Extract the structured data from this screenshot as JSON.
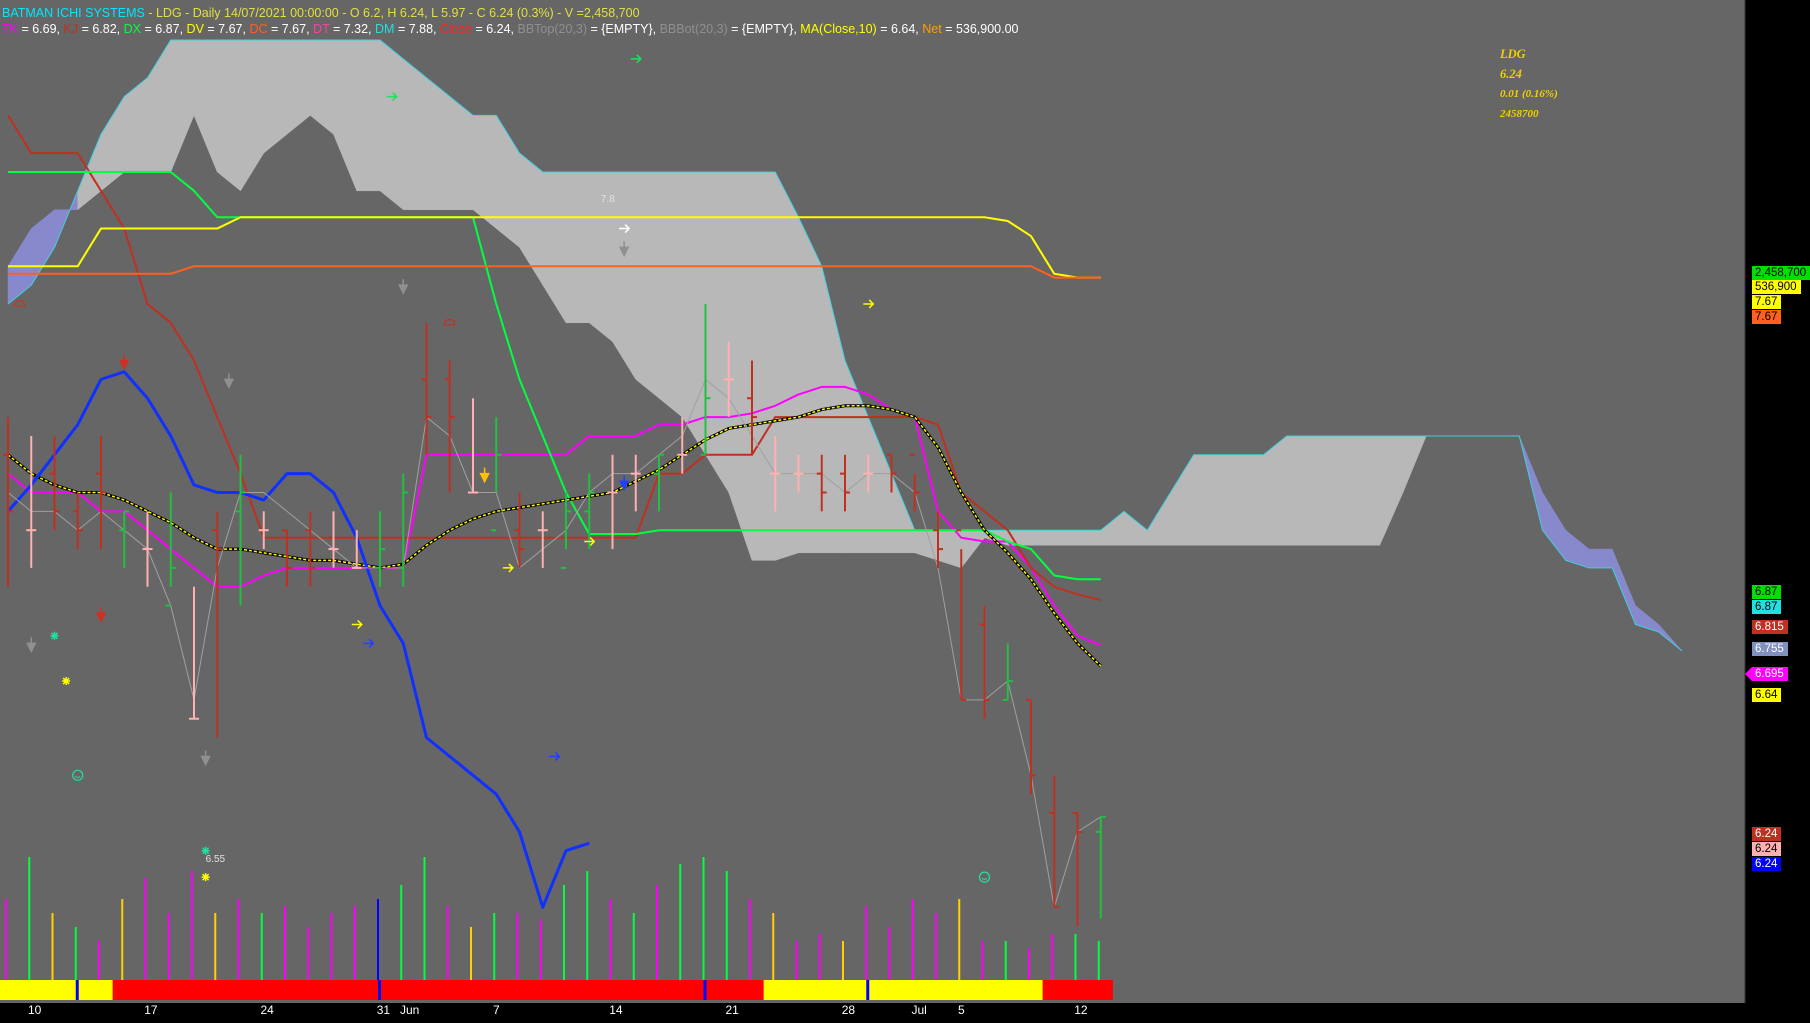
{
  "header": {
    "system": "BATMAN ICHI SYSTEMS",
    "symbol": "LDG",
    "period": "Daily",
    "date": "14/07/2021 00:00:00",
    "ohlc": "O 6.2, H 6.24, L 5.97",
    "close": "C 6.24 (0.3%)",
    "volume": "V =2,458,700"
  },
  "indicators": [
    {
      "label": "TK",
      "value": " = 6.69, ",
      "color": "#ff00ff"
    },
    {
      "label": "KJ",
      "value": " = 6.82, ",
      "color": "#c03020"
    },
    {
      "label": "DX",
      "value": " = 6.87, ",
      "color": "#00ff40"
    },
    {
      "label": "DV",
      "value": " = 7.67, ",
      "color": "#ffff00"
    },
    {
      "label": "DC",
      "value": " = 7.67, ",
      "color": "#ff6020"
    },
    {
      "label": "DT",
      "value": " = 7.32, ",
      "color": "#ff40a0"
    },
    {
      "label": "DM",
      "value": " = 7.88, ",
      "color": "#20e0e0"
    },
    {
      "label": "Close",
      "value": " = 6.24, ",
      "color": "#ff2020"
    },
    {
      "label": "BBTop(20,3)",
      "value": " = {EMPTY}, ",
      "color": "#909090"
    },
    {
      "label": "BBBot(20,3)",
      "value": " = {EMPTY}, ",
      "color": "#909090"
    },
    {
      "label": "MA(Close,10)",
      "value": " = 6.64, ",
      "color": "#ffff00"
    },
    {
      "label": "Net",
      "value": " = 536,900.00",
      "color": "#ffa000"
    }
  ],
  "quote": {
    "symbol": "LDG",
    "last": "6.24",
    "change": "0.01 (0.16%)",
    "volume": "2458700"
  },
  "axis_labels": [
    {
      "text": "2,458,700",
      "bg": "#00e000",
      "fg": "#000000",
      "tip": false
    },
    {
      "text": "536,900",
      "bg": "#ffff00",
      "fg": "#000000",
      "tip": false
    },
    {
      "text": "7.67",
      "bg": "#ffff00",
      "fg": "#000000",
      "tip": false
    },
    {
      "text": "7.67",
      "bg": "#ff6020",
      "fg": "#000000",
      "tip": false
    },
    {
      "text": "6.87",
      "bg": "#00e000",
      "fg": "#000000",
      "tip": false
    },
    {
      "text": "6.87",
      "bg": "#20e0e0",
      "fg": "#000000",
      "tip": false
    },
    {
      "text": "6.815",
      "bg": "#c03020",
      "fg": "#ffffff",
      "tip": false
    },
    {
      "text": "6.755",
      "bg": "#8090c0",
      "fg": "#ffffff",
      "tip": false
    },
    {
      "text": "6.695",
      "bg": "#ff00ff",
      "fg": "#ffffff",
      "tip": true
    },
    {
      "text": "6.64",
      "bg": "#ffff00",
      "fg": "#000000",
      "tip": false
    },
    {
      "text": "6.24",
      "bg": "#c03020",
      "fg": "#ffffff",
      "tip": false
    },
    {
      "text": "6.24",
      "bg": "#ffb0b0",
      "fg": "#000000",
      "tip": false
    },
    {
      "text": "6.24",
      "bg": "#0000ff",
      "fg": "#ffffff",
      "tip": false
    }
  ],
  "notes": [
    {
      "text": "7.8"
    },
    {
      "text": "6.55"
    }
  ],
  "chart_data": {
    "type": "line",
    "price_range": [
      5.9,
      8.3
    ],
    "x": [
      "10",
      "11",
      "12",
      "13",
      "14",
      "17",
      "18",
      "19",
      "20",
      "21",
      "24",
      "25",
      "26",
      "27",
      "28",
      "31",
      "1",
      "2",
      "3",
      "4",
      "7",
      "8",
      "9",
      "10",
      "11",
      "14",
      "15",
      "16",
      "17",
      "18",
      "21",
      "22",
      "23",
      "24",
      "25",
      "28",
      "29",
      "30",
      "1",
      "2",
      "5",
      "6",
      "7",
      "8",
      "9",
      "12",
      "13",
      "14"
    ],
    "x_tick_labels": [
      {
        "i": 0,
        "label": "10"
      },
      {
        "i": 5,
        "label": "17"
      },
      {
        "i": 10,
        "label": "24"
      },
      {
        "i": 15,
        "label": "31"
      },
      {
        "i": 16,
        "label": "Jun"
      },
      {
        "i": 20,
        "label": "7"
      },
      {
        "i": 25,
        "label": "14"
      },
      {
        "i": 30,
        "label": "21"
      },
      {
        "i": 35,
        "label": "28"
      },
      {
        "i": 38,
        "label": "Jul"
      },
      {
        "i": 40,
        "label": "5"
      },
      {
        "i": 45,
        "label": "12"
      }
    ],
    "ohlc": [
      [
        7.2,
        7.3,
        6.85,
        7.05
      ],
      [
        7.0,
        7.25,
        6.9,
        7.0
      ],
      [
        7.15,
        7.25,
        7.0,
        7.05
      ],
      [
        7.05,
        7.1,
        6.95,
        7.0
      ],
      [
        7.15,
        7.25,
        6.95,
        7.1
      ],
      [
        7.0,
        7.05,
        6.9,
        7.05
      ],
      [
        6.95,
        7.05,
        6.85,
        6.95
      ],
      [
        6.8,
        7.1,
        6.85,
        6.9
      ],
      [
        6.5,
        6.85,
        6.5,
        6.5
      ],
      [
        7.0,
        7.05,
        6.45,
        6.95
      ],
      [
        7.05,
        7.2,
        6.8,
        7.1
      ],
      [
        7.0,
        7.05,
        6.95,
        7.0
      ],
      [
        7.0,
        7.0,
        6.85,
        6.9
      ],
      [
        7.0,
        7.05,
        6.85,
        6.9
      ],
      [
        6.95,
        7.05,
        6.9,
        6.95
      ],
      [
        6.9,
        7.0,
        6.9,
        6.9
      ],
      [
        6.9,
        7.05,
        6.85,
        6.95
      ],
      [
        6.9,
        7.15,
        6.85,
        7.1
      ],
      [
        7.4,
        7.55,
        7.2,
        7.3
      ],
      [
        7.4,
        7.45,
        7.1,
        7.3
      ],
      [
        7.1,
        7.35,
        7.1,
        7.1
      ],
      [
        7.0,
        7.3,
        7.1,
        7.2
      ],
      [
        7.0,
        7.1,
        6.9,
        6.95
      ],
      [
        7.0,
        7.05,
        6.9,
        7.0
      ],
      [
        6.9,
        7.1,
        6.95,
        7.05
      ],
      [
        7.05,
        7.15,
        6.95,
        7.1
      ],
      [
        7.1,
        7.2,
        6.95,
        7.1
      ],
      [
        7.15,
        7.2,
        7.05,
        7.15
      ],
      [
        7.15,
        7.2,
        7.05,
        7.2
      ],
      [
        7.2,
        7.3,
        7.15,
        7.2
      ],
      [
        7.2,
        7.6,
        7.2,
        7.35
      ],
      [
        7.4,
        7.5,
        7.3,
        7.4
      ],
      [
        7.35,
        7.45,
        7.2,
        7.3
      ],
      [
        7.15,
        7.25,
        7.05,
        7.15
      ],
      [
        7.15,
        7.2,
        7.1,
        7.15
      ],
      [
        7.15,
        7.2,
        7.05,
        7.1
      ],
      [
        7.15,
        7.2,
        7.05,
        7.1
      ],
      [
        7.15,
        7.2,
        7.1,
        7.15
      ],
      [
        7.2,
        7.2,
        7.1,
        7.15
      ],
      [
        7.2,
        7.15,
        7.05,
        7.1
      ],
      [
        7.0,
        7.05,
        6.9,
        6.95
      ],
      [
        7.0,
        6.95,
        6.55,
        6.55
      ],
      [
        6.75,
        6.8,
        6.5,
        6.55
      ],
      [
        6.55,
        6.7,
        6.55,
        6.6
      ],
      [
        6.55,
        6.55,
        6.3,
        6.35
      ],
      [
        6.25,
        6.35,
        6.0,
        6.0
      ],
      [
        6.25,
        6.25,
        5.95,
        6.2
      ],
      [
        6.2,
        6.24,
        5.97,
        6.24
      ]
    ],
    "series": [
      {
        "name": "TK",
        "color": "#ff00ff",
        "values": [
          7.15,
          7.1,
          7.1,
          7.1,
          7.05,
          7.05,
          7.0,
          6.95,
          6.9,
          6.85,
          6.85,
          6.88,
          6.9,
          6.9,
          6.9,
          6.9,
          6.9,
          6.9,
          7.2,
          7.2,
          7.2,
          7.2,
          7.2,
          7.2,
          7.2,
          7.25,
          7.25,
          7.25,
          7.28,
          7.28,
          7.3,
          7.3,
          7.31,
          7.33,
          7.36,
          7.38,
          7.38,
          7.36,
          7.32,
          7.3,
          7.05,
          6.98,
          6.97,
          6.97,
          6.9,
          6.8,
          6.72,
          6.695
        ]
      },
      {
        "name": "KJ",
        "color": "#c03020",
        "values": [
          8.1,
          8.0,
          8.0,
          8.0,
          7.9,
          7.8,
          7.6,
          7.55,
          7.45,
          7.3,
          7.15,
          6.98,
          6.98,
          6.98,
          6.98,
          6.98,
          6.98,
          6.98,
          6.98,
          6.98,
          6.98,
          6.98,
          6.98,
          6.98,
          6.98,
          6.98,
          6.98,
          6.98,
          7.15,
          7.15,
          7.2,
          7.2,
          7.2,
          7.3,
          7.3,
          7.3,
          7.3,
          7.3,
          7.3,
          7.3,
          7.28,
          7.1,
          7.05,
          7.0,
          6.9,
          6.85,
          6.83,
          6.815
        ]
      },
      {
        "name": "DX",
        "color": "#00ff40",
        "values": [
          7.95,
          7.95,
          7.95,
          7.95,
          7.95,
          7.95,
          7.95,
          7.95,
          7.9,
          7.83,
          7.83,
          7.83,
          7.83,
          7.83,
          7.83,
          7.83,
          7.83,
          7.83,
          7.83,
          7.83,
          7.83,
          7.6,
          7.4,
          7.25,
          7.1,
          6.99,
          6.99,
          6.99,
          7.0,
          7.0,
          7.0,
          7.0,
          7.0,
          7.0,
          7.0,
          7.0,
          7.0,
          7.0,
          7.0,
          7.0,
          7.0,
          7.0,
          7.0,
          6.97,
          6.95,
          6.88,
          6.87,
          6.87
        ]
      },
      {
        "name": "DV",
        "color": "#ffff00",
        "values": [
          7.7,
          7.7,
          7.7,
          7.7,
          7.8,
          7.8,
          7.8,
          7.8,
          7.8,
          7.8,
          7.83,
          7.83,
          7.83,
          7.83,
          7.83,
          7.83,
          7.83,
          7.83,
          7.83,
          7.83,
          7.83,
          7.83,
          7.83,
          7.83,
          7.83,
          7.83,
          7.83,
          7.83,
          7.83,
          7.83,
          7.83,
          7.83,
          7.83,
          7.83,
          7.83,
          7.83,
          7.83,
          7.83,
          7.83,
          7.83,
          7.83,
          7.83,
          7.83,
          7.82,
          7.78,
          7.68,
          7.67,
          7.67
        ]
      },
      {
        "name": "DC",
        "color": "#ff6020",
        "values": [
          7.68,
          7.68,
          7.68,
          7.68,
          7.68,
          7.68,
          7.68,
          7.68,
          7.7,
          7.7,
          7.7,
          7.7,
          7.7,
          7.7,
          7.7,
          7.7,
          7.7,
          7.7,
          7.7,
          7.7,
          7.7,
          7.7,
          7.7,
          7.7,
          7.7,
          7.7,
          7.7,
          7.7,
          7.7,
          7.7,
          7.7,
          7.7,
          7.7,
          7.7,
          7.7,
          7.7,
          7.7,
          7.7,
          7.7,
          7.7,
          7.7,
          7.7,
          7.7,
          7.7,
          7.7,
          7.67,
          7.67,
          7.67
        ]
      },
      {
        "name": "MA(Close,10)",
        "color": "#ffff00",
        "dashed": true,
        "values": [
          7.2,
          7.15,
          7.12,
          7.1,
          7.1,
          7.08,
          7.05,
          7.02,
          6.98,
          6.95,
          6.95,
          6.94,
          6.93,
          6.92,
          6.92,
          6.91,
          6.9,
          6.91,
          6.96,
          7.0,
          7.03,
          7.05,
          7.06,
          7.07,
          7.08,
          7.09,
          7.1,
          7.13,
          7.16,
          7.2,
          7.24,
          7.27,
          7.28,
          7.29,
          7.3,
          7.32,
          7.33,
          7.33,
          7.32,
          7.3,
          7.22,
          7.1,
          7.0,
          6.94,
          6.87,
          6.78,
          6.7,
          6.64
        ]
      },
      {
        "name": "Blue",
        "color": "#1030ff",
        "width": 3,
        "values": [
          7.05,
          7.12,
          7.2,
          7.28,
          7.4,
          7.42,
          7.35,
          7.25,
          7.12,
          7.1,
          7.1,
          7.08,
          7.15,
          7.15,
          7.1,
          6.98,
          6.8,
          6.7,
          6.45,
          6.4,
          6.35,
          6.3,
          6.2,
          6.0,
          6.15,
          6.17
        ]
      },
      {
        "name": "Chikou",
        "color": "#a0a0a0",
        "width": 1,
        "values": [
          7.1,
          7.05,
          7.05,
          7.0,
          7.05,
          7.0,
          6.95,
          6.8,
          6.55,
          6.9,
          7.1,
          7.1,
          7.05,
          7.0,
          6.95,
          6.9,
          6.9,
          6.9,
          7.3,
          7.25,
          7.1,
          7.1,
          6.9,
          6.95,
          7.0,
          7.1,
          7.15,
          7.15,
          7.2,
          7.25,
          7.4,
          7.35,
          7.25,
          7.15,
          7.15,
          7.15,
          7.1,
          7.15,
          7.15,
          7.1,
          6.9,
          6.55,
          6.55,
          6.6,
          6.35,
          6.0,
          6.2,
          6.24
        ]
      }
    ],
    "cloud": {
      "x_start": 0,
      "upper": [
        7.6,
        7.65,
        7.75,
        7.9,
        8.05,
        8.15,
        8.2,
        8.3,
        8.3,
        8.3,
        8.3,
        8.3,
        8.3,
        8.3,
        8.3,
        8.3,
        8.3,
        8.25,
        8.2,
        8.15,
        8.1,
        8.1,
        8.0,
        7.95,
        7.95,
        7.95,
        7.95,
        7.95,
        7.95,
        7.95,
        7.95,
        7.95,
        7.95,
        7.95,
        7.83,
        7.7,
        7.45,
        7.3,
        7.15,
        7.0,
        7.0,
        7.0,
        7.0,
        7.0,
        7.0,
        7.0,
        7.0,
        7.0,
        7.05,
        7.0,
        7.1,
        7.2,
        7.2,
        7.2,
        7.2,
        7.25,
        7.25,
        7.25,
        7.25,
        7.25,
        7.25,
        7.25,
        7.25,
        7.25,
        7.25,
        7.25,
        7.0,
        6.92,
        6.9,
        6.9,
        6.75,
        6.73,
        6.68
      ],
      "lower": [
        7.7,
        7.8,
        7.85,
        7.85,
        7.9,
        7.95,
        7.95,
        7.95,
        8.1,
        7.95,
        7.9,
        8.0,
        8.05,
        8.1,
        8.05,
        7.9,
        7.9,
        7.85,
        7.85,
        7.85,
        7.85,
        7.8,
        7.75,
        7.65,
        7.55,
        7.55,
        7.5,
        7.4,
        7.35,
        7.3,
        7.2,
        7.1,
        6.92,
        6.92,
        6.94,
        6.94,
        6.94,
        6.94,
        6.94,
        6.94,
        6.92,
        6.9,
        6.98,
        6.96,
        6.96,
        6.96,
        6.96,
        6.96,
        6.96,
        6.96,
        6.96,
        6.96,
        6.96,
        6.96,
        6.96,
        6.96,
        6.96,
        6.96,
        6.96,
        6.96,
        7.1,
        7.25,
        7.25,
        7.25,
        7.25,
        7.25,
        7.1,
        7.0,
        6.95,
        6.95,
        6.8,
        6.75,
        6.68
      ]
    },
    "volume": [
      {
        "h": 0.6,
        "c": "#ff00ff"
      },
      {
        "h": 0.9,
        "c": "#00ff40"
      },
      {
        "h": 0.5,
        "c": "#ffd000"
      },
      {
        "h": 0.4,
        "c": "#00ff40"
      },
      {
        "h": 0.3,
        "c": "#ff00ff"
      },
      {
        "h": 0.6,
        "c": "#ffd000"
      },
      {
        "h": 0.75,
        "c": "#ff00ff"
      },
      {
        "h": 0.5,
        "c": "#ff00ff"
      },
      {
        "h": 0.8,
        "c": "#ff00ff"
      },
      {
        "h": 0.5,
        "c": "#ffd000"
      },
      {
        "h": 0.6,
        "c": "#ff00ff"
      },
      {
        "h": 0.5,
        "c": "#00ff40"
      },
      {
        "h": 0.55,
        "c": "#ff00ff"
      },
      {
        "h": 0.4,
        "c": "#ff00ff"
      },
      {
        "h": 0.5,
        "c": "#ff00ff"
      },
      {
        "h": 0.55,
        "c": "#ff00ff"
      },
      {
        "h": 0.6,
        "c": "#0000ff"
      },
      {
        "h": 0.7,
        "c": "#00ff40"
      },
      {
        "h": 0.9,
        "c": "#00ff40"
      },
      {
        "h": 0.55,
        "c": "#ff00ff"
      },
      {
        "h": 0.4,
        "c": "#ffd000"
      },
      {
        "h": 0.5,
        "c": "#00ff40"
      },
      {
        "h": 0.5,
        "c": "#ff00ff"
      },
      {
        "h": 0.45,
        "c": "#ff00ff"
      },
      {
        "h": 0.7,
        "c": "#00ff40"
      },
      {
        "h": 0.8,
        "c": "#00ff40"
      },
      {
        "h": 0.6,
        "c": "#ff00ff"
      },
      {
        "h": 0.5,
        "c": "#00ff40"
      },
      {
        "h": 0.7,
        "c": "#ff00ff"
      },
      {
        "h": 0.85,
        "c": "#00ff40"
      },
      {
        "h": 0.9,
        "c": "#00ff40"
      },
      {
        "h": 0.8,
        "c": "#00ff40"
      },
      {
        "h": 0.6,
        "c": "#ff00ff"
      },
      {
        "h": 0.5,
        "c": "#ffd000"
      },
      {
        "h": 0.3,
        "c": "#ff00ff"
      },
      {
        "h": 0.35,
        "c": "#ff00ff"
      },
      {
        "h": 0.3,
        "c": "#ffd000"
      },
      {
        "h": 0.55,
        "c": "#ff00ff"
      },
      {
        "h": 0.4,
        "c": "#ff00ff"
      },
      {
        "h": 0.6,
        "c": "#ff00ff"
      },
      {
        "h": 0.5,
        "c": "#ff00ff"
      },
      {
        "h": 0.6,
        "c": "#ffd000"
      },
      {
        "h": 0.3,
        "c": "#ff00ff"
      },
      {
        "h": 0.3,
        "c": "#00ff40"
      },
      {
        "h": 0.25,
        "c": "#ff00ff"
      },
      {
        "h": 0.35,
        "c": "#ff00ff"
      },
      {
        "h": 0.35,
        "c": "#00ff40"
      },
      {
        "h": 0.3,
        "c": "#00ff40"
      }
    ],
    "state_band": [
      "Y",
      "Y",
      "Y",
      "Y",
      "Y",
      "R",
      "R",
      "R",
      "R",
      "R",
      "R",
      "R",
      "R",
      "R",
      "R",
      "R",
      "R",
      "R",
      "R",
      "R",
      "R",
      "R",
      "R",
      "R",
      "R",
      "R",
      "R",
      "R",
      "R",
      "R",
      "R",
      "R",
      "R",
      "Y",
      "Y",
      "Y",
      "Y",
      "Y",
      "Y",
      "Y",
      "Y",
      "Y",
      "Y",
      "Y",
      "Y",
      "R",
      "R",
      "R"
    ],
    "blue_ticks": [
      3,
      16,
      30,
      37
    ]
  }
}
